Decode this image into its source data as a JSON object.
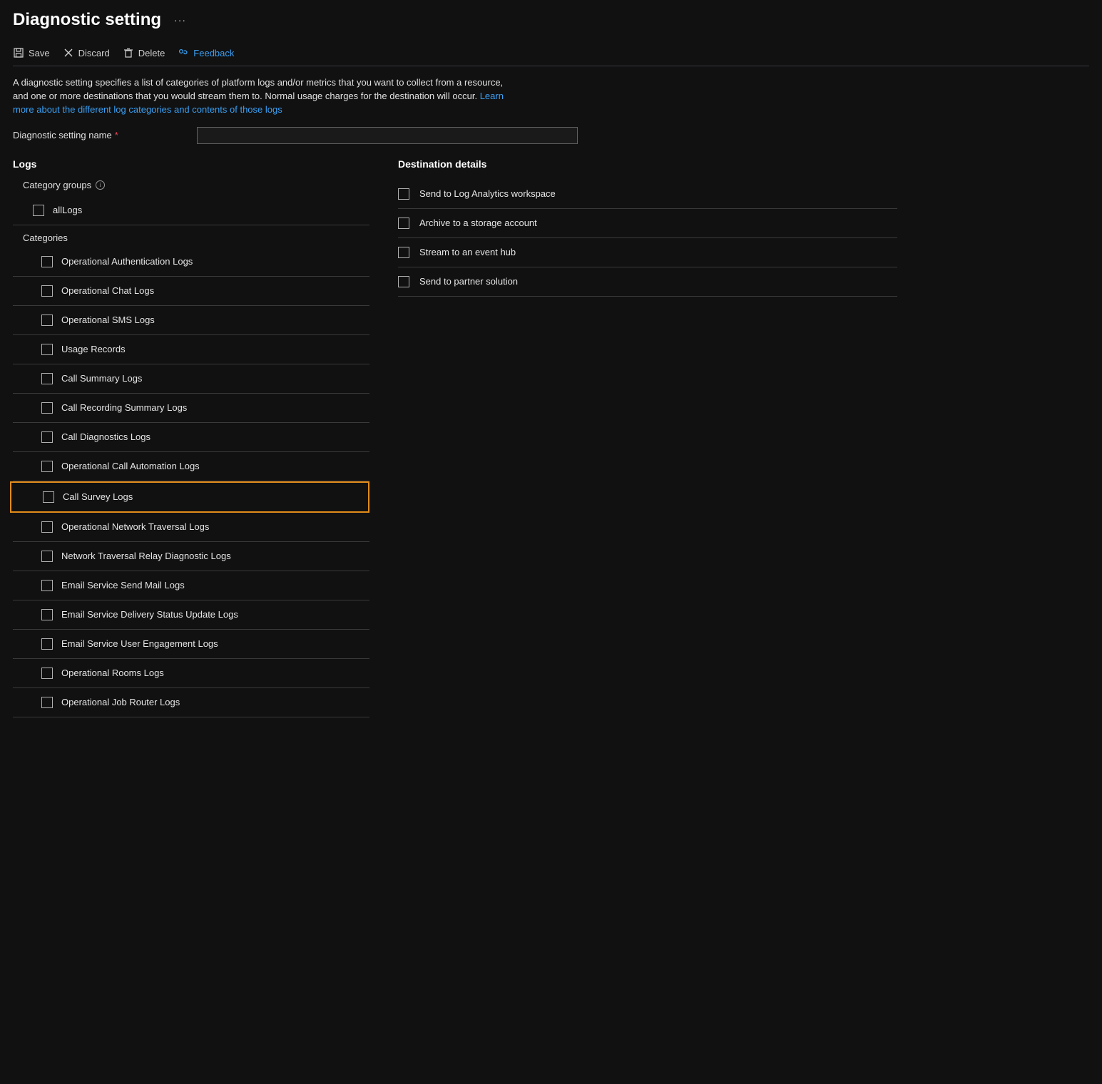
{
  "header": {
    "title": "Diagnostic setting"
  },
  "toolbar": {
    "save": "Save",
    "discard": "Discard",
    "delete": "Delete",
    "feedback": "Feedback"
  },
  "description": {
    "text1": "A diagnostic setting specifies a list of categories of platform logs and/or metrics that you want to collect from a resource, and one or more destinations that you would stream them to. Normal usage charges for the destination will occur. ",
    "link": "Learn more about the different log categories and contents of those logs"
  },
  "name_field": {
    "label": "Diagnostic setting name",
    "value": ""
  },
  "logs": {
    "title": "Logs",
    "category_groups_label": "Category groups",
    "groups": [
      {
        "label": "allLogs"
      }
    ],
    "categories_label": "Categories",
    "categories": [
      {
        "label": "Operational Authentication Logs",
        "highlight": false
      },
      {
        "label": "Operational Chat Logs",
        "highlight": false
      },
      {
        "label": "Operational SMS Logs",
        "highlight": false
      },
      {
        "label": "Usage Records",
        "highlight": false
      },
      {
        "label": "Call Summary Logs",
        "highlight": false
      },
      {
        "label": "Call Recording Summary Logs",
        "highlight": false
      },
      {
        "label": "Call Diagnostics Logs",
        "highlight": false
      },
      {
        "label": "Operational Call Automation Logs",
        "highlight": false
      },
      {
        "label": "Call Survey Logs",
        "highlight": true
      },
      {
        "label": "Operational Network Traversal Logs",
        "highlight": false
      },
      {
        "label": "Network Traversal Relay Diagnostic Logs",
        "highlight": false
      },
      {
        "label": "Email Service Send Mail Logs",
        "highlight": false
      },
      {
        "label": "Email Service Delivery Status Update Logs",
        "highlight": false
      },
      {
        "label": "Email Service User Engagement Logs",
        "highlight": false
      },
      {
        "label": "Operational Rooms Logs",
        "highlight": false
      },
      {
        "label": "Operational Job Router Logs",
        "highlight": false
      }
    ]
  },
  "destination": {
    "title": "Destination details",
    "options": [
      {
        "label": "Send to Log Analytics workspace"
      },
      {
        "label": "Archive to a storage account"
      },
      {
        "label": "Stream to an event hub"
      },
      {
        "label": "Send to partner solution"
      }
    ]
  }
}
